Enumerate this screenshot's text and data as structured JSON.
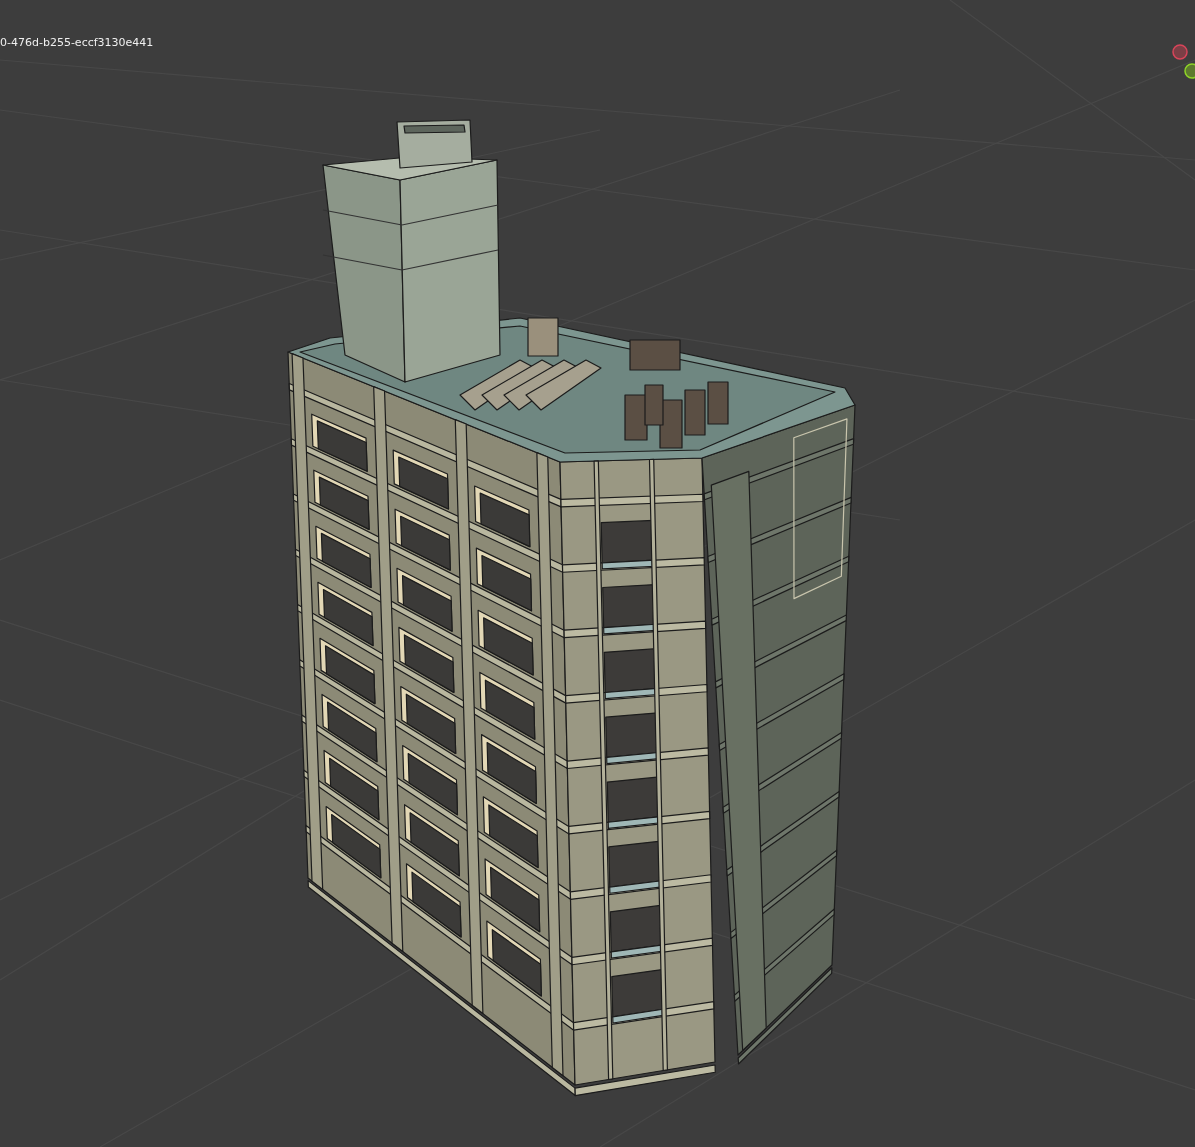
{
  "viewport": {
    "object_name": "0-476d-b255-eccf3130e441"
  }
}
